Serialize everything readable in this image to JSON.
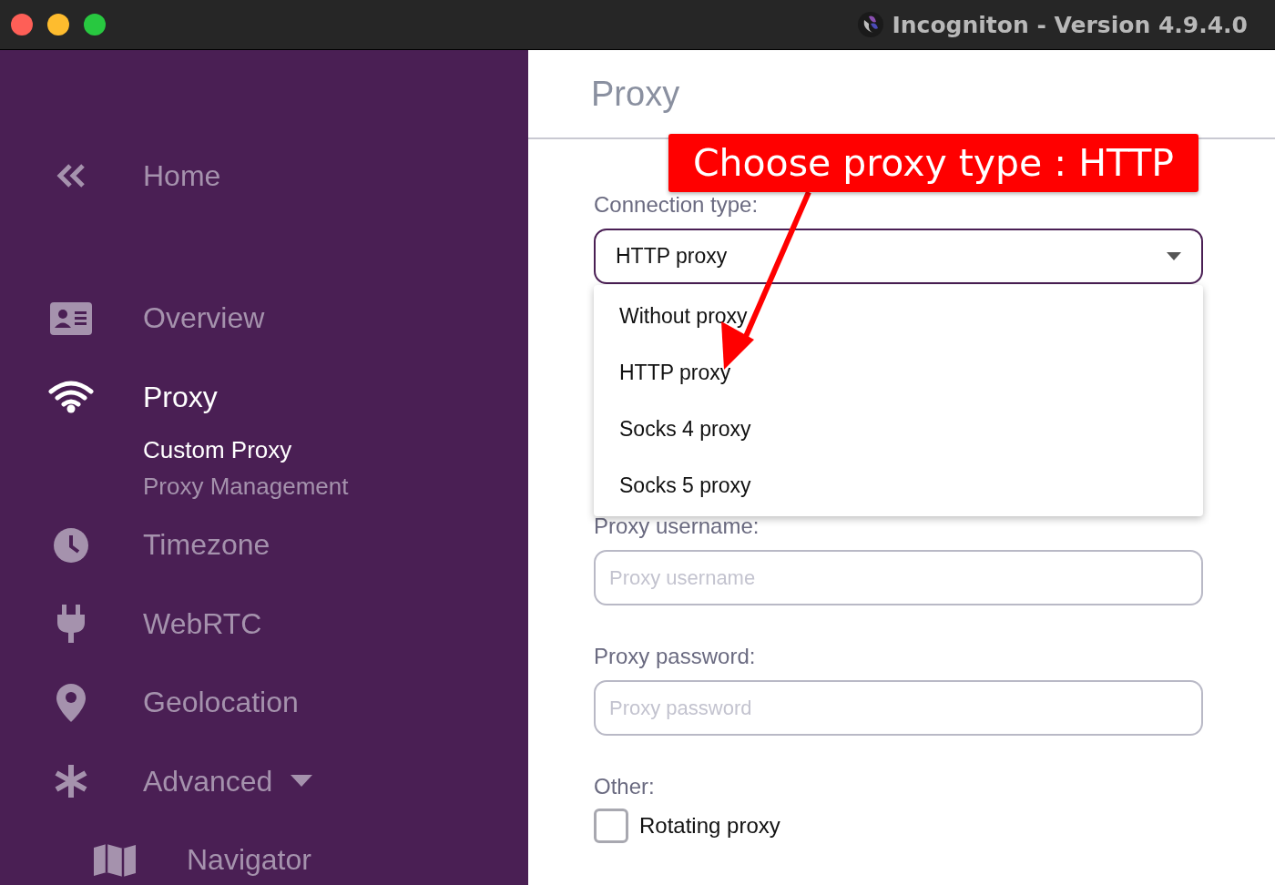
{
  "window": {
    "title": "Incogniton - Version 4.9.4.0"
  },
  "sidebar": {
    "items": [
      {
        "label": "Home",
        "selected": false
      },
      {
        "label": "Overview",
        "selected": false
      },
      {
        "label": "Proxy",
        "selected": true,
        "children": [
          {
            "label": "Custom Proxy",
            "selected": true
          },
          {
            "label": "Proxy Management",
            "selected": false
          }
        ]
      },
      {
        "label": "Timezone",
        "selected": false
      },
      {
        "label": "WebRTC",
        "selected": false
      },
      {
        "label": "Geolocation",
        "selected": false
      },
      {
        "label": "Advanced",
        "selected": false,
        "expanded": true,
        "children": [
          {
            "label": "Navigator",
            "selected": false
          }
        ]
      }
    ]
  },
  "page": {
    "title": "Proxy"
  },
  "connection_type": {
    "label": "Connection type:",
    "value": "HTTP proxy",
    "expanded": true,
    "options": [
      {
        "label": "Without proxy"
      },
      {
        "label": "HTTP proxy"
      },
      {
        "label": "Socks 4 proxy"
      },
      {
        "label": "Socks 5 proxy"
      }
    ]
  },
  "fields": [
    {
      "label": "Proxy username:",
      "placeholder": "Proxy username"
    },
    {
      "label": "Proxy password:",
      "placeholder": "Proxy password"
    }
  ],
  "other": {
    "label": "Other:",
    "checkbox": {
      "label": "Rotating proxy",
      "checked": false
    }
  },
  "annotation": {
    "text": "Choose proxy type : HTTP"
  }
}
